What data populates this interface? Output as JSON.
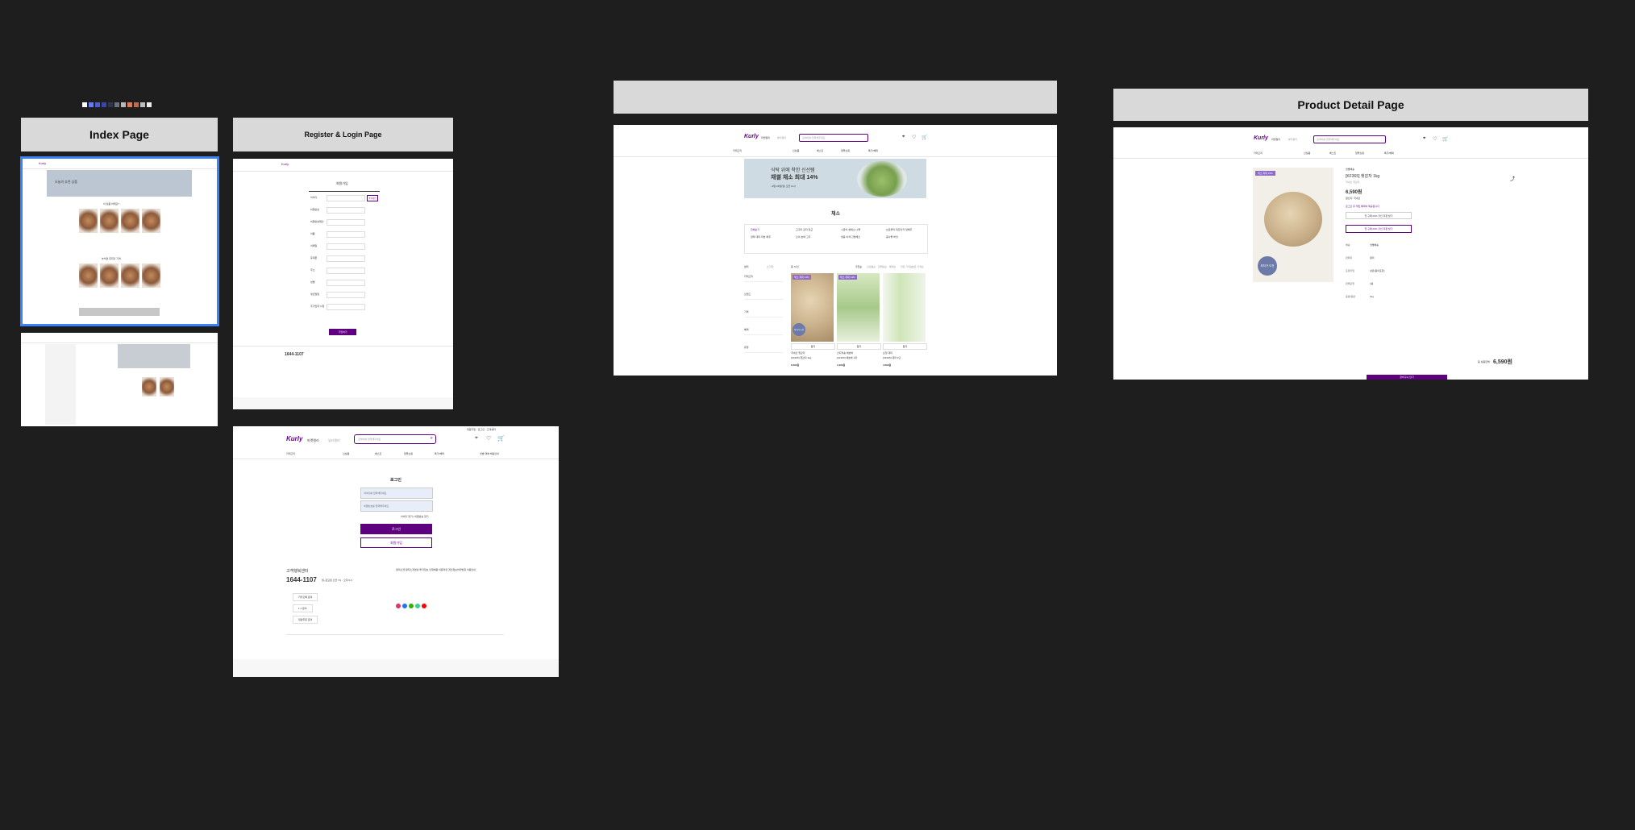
{
  "palette": [
    "#ffffff",
    "#5f7cff",
    "#4d5bd8",
    "#3a45a8",
    "#2f3550",
    "#6b6f7e",
    "#b9b9b9",
    "#e07b5a",
    "#c06a4f",
    "#bdbdbd",
    "#ececec"
  ],
  "frames": {
    "index": {
      "title": "Index Page"
    },
    "register": {
      "title": "Register & Login Page"
    },
    "category": {
      "title": ""
    },
    "detail": {
      "title": "Product Detail Page"
    }
  },
  "kurly": {
    "logo": "Kurly",
    "tab_market": "마켓컬리",
    "tab_beauty": "뷰티컬리",
    "search_placeholder": "검색어를 입력해주세요",
    "top_links": [
      "회원가입",
      "로그인",
      "고객센터"
    ],
    "nav": [
      "카테고리",
      "신상품",
      "베스트",
      "알뜰쇼핑",
      "특가/혜택"
    ],
    "delivery_note": "샛별·택배 배송안내"
  },
  "category_page": {
    "banner_line1": "식탁 위에 착한 신선템",
    "banner_line2": "채썰 채소 최대 14%",
    "banner_line3": "~9월 23일(일) 오전 11시",
    "heading": "채소",
    "subcats": [
      "전체보기",
      "고구마·감자·당근",
      "시금치·쌈채소·나물",
      "브로콜리·파프리카·양배추",
      "양파·대파·마늘·배추",
      "오이·호박·고추",
      "냉동·이색·간편채소",
      "콩나물·버섯"
    ],
    "filter_title": "필터",
    "filter_reset": "초기화",
    "filter_groups": [
      "카테고리",
      "브랜드",
      "가격",
      "혜택",
      "유형"
    ],
    "sort_total": "총 72건",
    "sort_options": [
      "추천순",
      "신상품순",
      "판매량순",
      "혜택순",
      "낮은 가격순",
      "높은 가격순"
    ],
    "products": [
      {
        "badge": "채소 최대 14%",
        "cart": "담기",
        "desc": "[KF365] 햇감자 1kg",
        "sub": "국내산 햇감자",
        "price": "6,590원",
        "img": "potato",
        "stamp": "최저가 도전"
      },
      {
        "badge": "채소 최대 14%",
        "cart": "담기",
        "desc": "[KF365] 애호박 1개",
        "sub": "산지직송 애호박",
        "price": "1,990원",
        "img": "green"
      },
      {
        "badge": "",
        "cart": "담기",
        "desc": "[KF365] 대파 1단",
        "sub": "손질 대파",
        "price": "4,590원",
        "img": "leek"
      }
    ]
  },
  "detail_page": {
    "delivery": "샛별배송",
    "name": "[KF365] 햇감자 1kg",
    "origin_line": "국내산 햇감자",
    "price": "6,590원",
    "sub": "원산지: 국내산",
    "coupon_btn": "첫 구매 20% 할인 쿠폰 받기",
    "member_btn": "로그인 후 적립 혜택이 제공됩니다",
    "badge": "채소 최대 14%",
    "stamp": "최저가 도전",
    "info_labels": [
      "배송",
      "판매자",
      "포장타입",
      "판매단위",
      "중량/용량"
    ],
    "info_values": [
      "샛별배송",
      "컬리",
      "상온(종이포장)",
      "1봉",
      "1kg"
    ],
    "total_label": "총 상품금액:",
    "total_price": "6,590원",
    "cart_btn": "장바구니 담기"
  },
  "login_page": {
    "title": "로그인",
    "id_placeholder": "아이디를 입력해주세요",
    "pw_placeholder": "비밀번호를 입력해주세요",
    "find_links": "아이디 찾기 | 비밀번호 찾기",
    "login_btn": "로그인",
    "signup_btn": "회원가입",
    "cs_title": "고객행복센터",
    "cs_phone": "1644-1107",
    "cs_hours": "월~토요일 오전 7시 - 오후 6시",
    "cs_rows": [
      "카카오톡 문의",
      "1:1 문의",
      "대량주문 문의"
    ],
    "footer_links": [
      "컬리소개",
      "컬리소개영상",
      "투자정보",
      "인재채용",
      "이용약관",
      "개인정보처리방침",
      "이용안내"
    ]
  },
  "register_page": {
    "title": "회원가입",
    "fields": [
      "아이디",
      "비밀번호",
      "비밀번호확인",
      "이름",
      "이메일",
      "휴대폰",
      "주소",
      "성별",
      "생년월일",
      "추가입력 사항"
    ],
    "check_btn": "중복확인",
    "submit": "가입하기",
    "cs_phone": "1644-1107"
  },
  "index_page": {
    "banner": "오늘의 추천 상품",
    "section1": "이 상품 어때요?",
    "section2": "놓치면 후회할 가격"
  }
}
